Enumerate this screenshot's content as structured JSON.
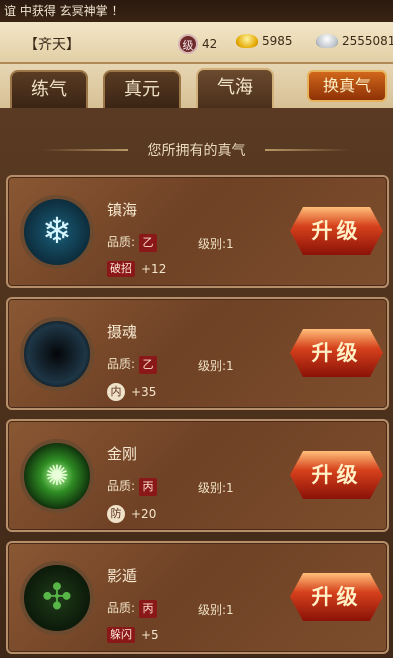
{
  "ticker": "谊 中获得 玄冥神掌 ！",
  "player": {
    "name": "【齐天】",
    "level_icon_text": "级",
    "level": "42",
    "gold": "5985",
    "silver": "2555081"
  },
  "tabs": [
    {
      "label": "练气",
      "active": false
    },
    {
      "label": "真元",
      "active": false
    },
    {
      "label": "气海",
      "active": true
    }
  ],
  "swap_button": "换真气",
  "section_title": "您所拥有的真气",
  "common": {
    "quality_label": "品质:",
    "upgrade_label": "升级"
  },
  "cards": [
    {
      "name": "镇海",
      "quality": "乙",
      "level": "级别:1",
      "attr_icon": "破招",
      "attr_value": "+12",
      "icon": "snowflake-orb-icon"
    },
    {
      "name": "摄魂",
      "quality": "乙",
      "level": "级别:1",
      "attr_icon": "内",
      "attr_value": "+35",
      "icon": "dark-vortex-orb-icon"
    },
    {
      "name": "金刚",
      "quality": "丙",
      "level": "级别:1",
      "attr_icon": "防",
      "attr_value": "+20",
      "icon": "green-glow-orb-icon"
    },
    {
      "name": "影遁",
      "quality": "丙",
      "level": "级别:1",
      "attr_icon": "躲闪",
      "attr_value": "+5",
      "icon": "green-rune-orb-icon"
    }
  ]
}
